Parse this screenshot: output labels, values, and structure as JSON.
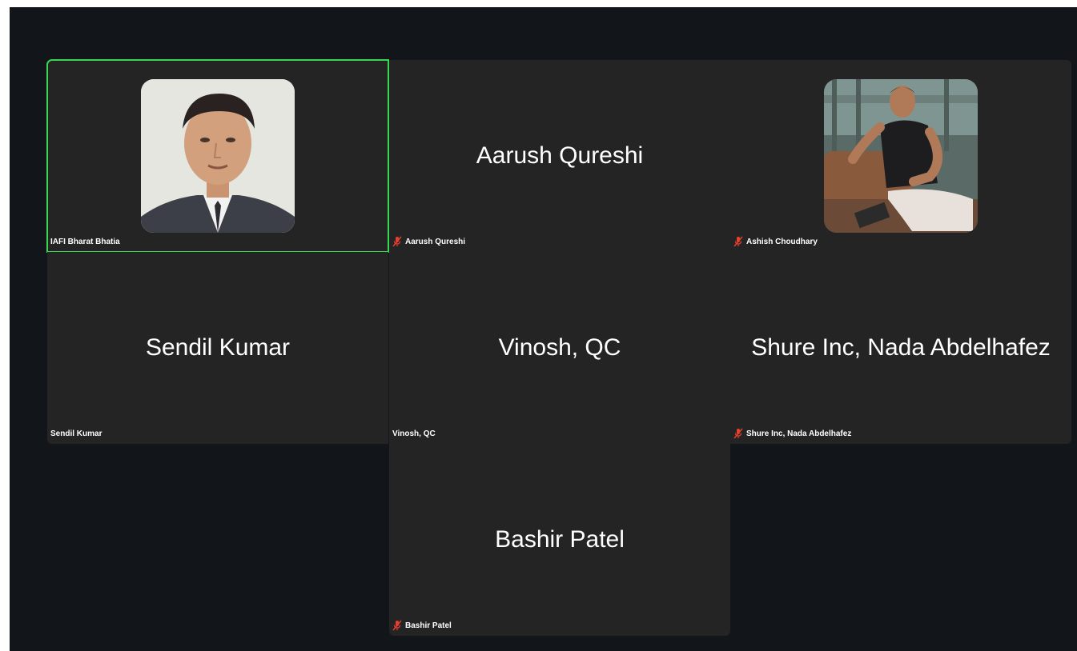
{
  "meeting": {
    "participants": [
      {
        "id": "p1",
        "name": "IAFI Bharat Bhatia",
        "display_name": "",
        "muted": false,
        "has_photo": true,
        "photo_icon": "profile-photo-man-suit",
        "active_speaker": true
      },
      {
        "id": "p2",
        "name": "Aarush Qureshi",
        "display_name": "Aarush Qureshi",
        "muted": true,
        "has_photo": false,
        "active_speaker": false
      },
      {
        "id": "p3",
        "name": "Ashish Choudhary",
        "display_name": "",
        "muted": true,
        "has_photo": true,
        "photo_icon": "profile-photo-man-seated",
        "active_speaker": false
      },
      {
        "id": "p4",
        "name": "Sendil Kumar",
        "display_name": "Sendil Kumar",
        "muted": false,
        "has_photo": false,
        "active_speaker": false
      },
      {
        "id": "p5",
        "name": "Vinosh, QC",
        "display_name": "Vinosh, QC",
        "muted": false,
        "has_photo": false,
        "active_speaker": false
      },
      {
        "id": "p6",
        "name": "Shure Inc, Nada Abdelhafez",
        "display_name": "Shure Inc, Nada Abdelhafez",
        "muted": true,
        "has_photo": false,
        "active_speaker": false
      },
      {
        "id": "p7",
        "name": "Bashir Patel",
        "display_name": "Bashir Patel",
        "muted": true,
        "has_photo": false,
        "active_speaker": false
      }
    ]
  },
  "colors": {
    "background": "#12151a",
    "tile": "#242424",
    "active_speaker_border": "#37d74f",
    "muted_mic": "#e5412f",
    "text": "#ffffff"
  },
  "icons": {
    "muted_mic": "mic-muted-icon"
  }
}
